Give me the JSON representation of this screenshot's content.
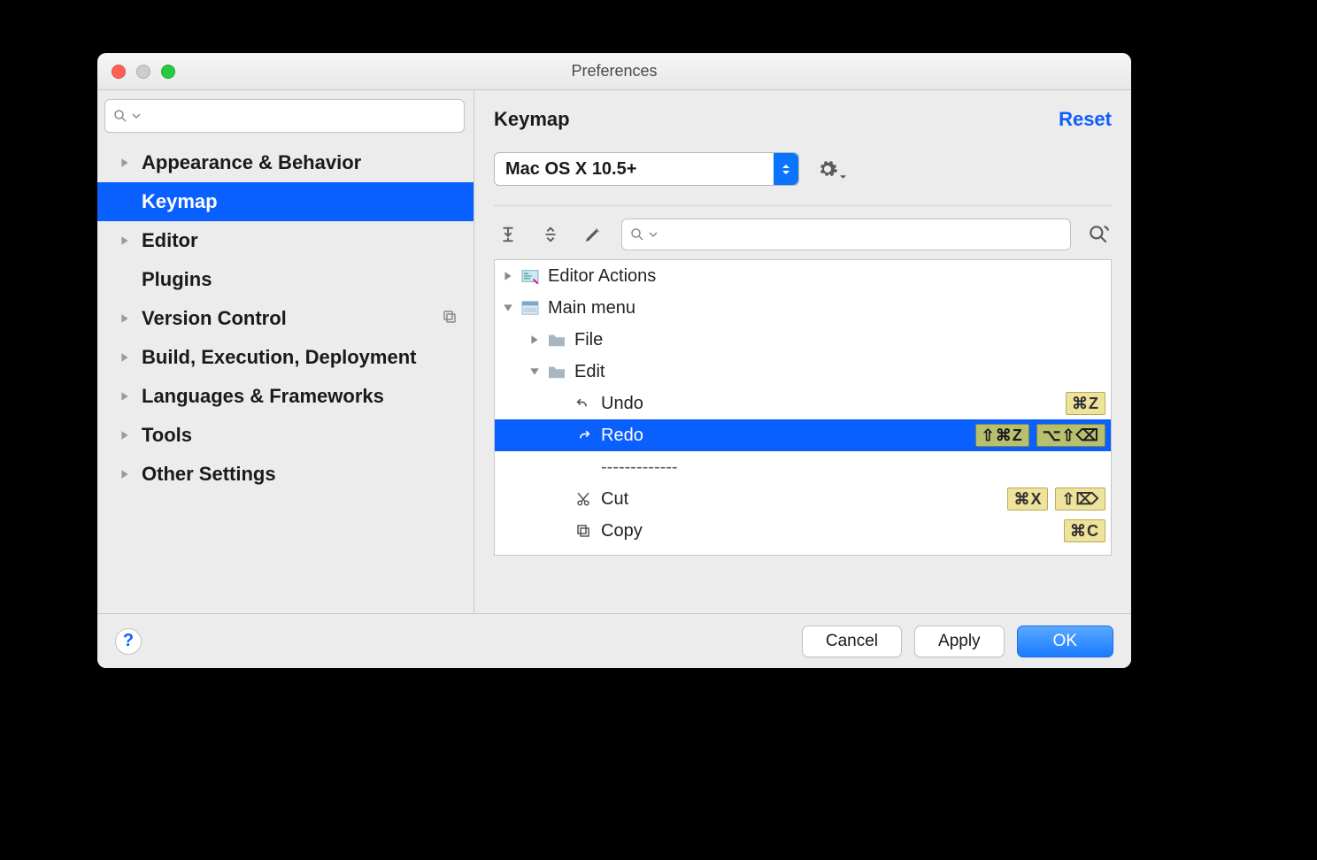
{
  "window": {
    "title": "Preferences"
  },
  "sidebar": {
    "search_placeholder": "",
    "items": [
      {
        "label": "Appearance & Behavior",
        "expandable": true
      },
      {
        "label": "Keymap",
        "selected": true
      },
      {
        "label": "Editor",
        "expandable": true
      },
      {
        "label": "Plugins"
      },
      {
        "label": "Version Control",
        "expandable": true,
        "badge": "copy"
      },
      {
        "label": "Build, Execution, Deployment",
        "expandable": true
      },
      {
        "label": "Languages & Frameworks",
        "expandable": true
      },
      {
        "label": "Tools",
        "expandable": true
      },
      {
        "label": "Other Settings",
        "expandable": true
      }
    ]
  },
  "page": {
    "title": "Keymap",
    "reset": "Reset",
    "scheme": "Mac OS X 10.5+"
  },
  "tree": {
    "editor_actions": "Editor Actions",
    "main_menu": "Main menu",
    "file": "File",
    "edit": "Edit",
    "undo": {
      "label": "Undo",
      "shortcuts": [
        "⌘Z"
      ]
    },
    "redo": {
      "label": "Redo",
      "shortcuts": [
        "⇧⌘Z",
        "⌥⇧⌫"
      ]
    },
    "separator": "-------------",
    "cut": {
      "label": "Cut",
      "shortcuts": [
        "⌘X",
        "⇧⌦"
      ]
    },
    "copy": {
      "label": "Copy",
      "shortcuts": [
        "⌘C"
      ]
    }
  },
  "buttons": {
    "cancel": "Cancel",
    "apply": "Apply",
    "ok": "OK"
  }
}
